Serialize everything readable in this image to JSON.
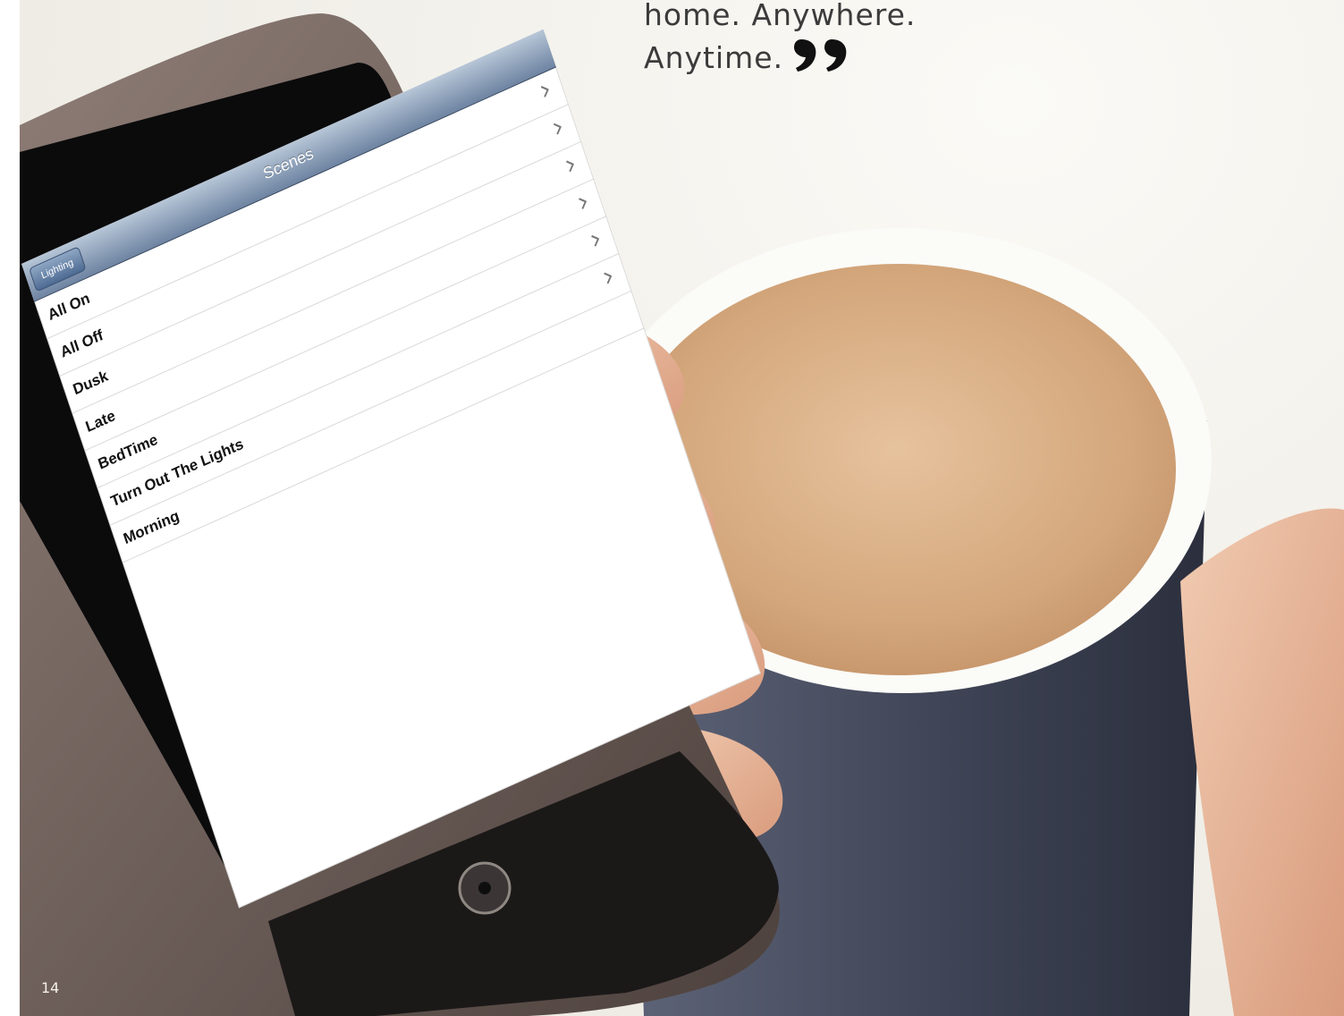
{
  "quote": {
    "line1": "home. Anywhere.",
    "line2": "Anytime."
  },
  "page_number": "14",
  "phone_screen": {
    "title": "Scenes",
    "back_label": "Lighting",
    "items": [
      {
        "label": "All On"
      },
      {
        "label": "All Off"
      },
      {
        "label": "Dusk"
      },
      {
        "label": "Late"
      },
      {
        "label": "BedTime"
      },
      {
        "label": "Turn Out The Lights"
      },
      {
        "label": "Morning"
      }
    ]
  },
  "icons": {
    "chevron": "chevron-right-icon",
    "home_button": "home-button-icon",
    "quote": "closing-quote-icon"
  },
  "colors": {
    "text": "#3b3b3b",
    "nav_bar": "#6e84a2",
    "mug": "#3f4456",
    "tea": "#d9b08a"
  }
}
